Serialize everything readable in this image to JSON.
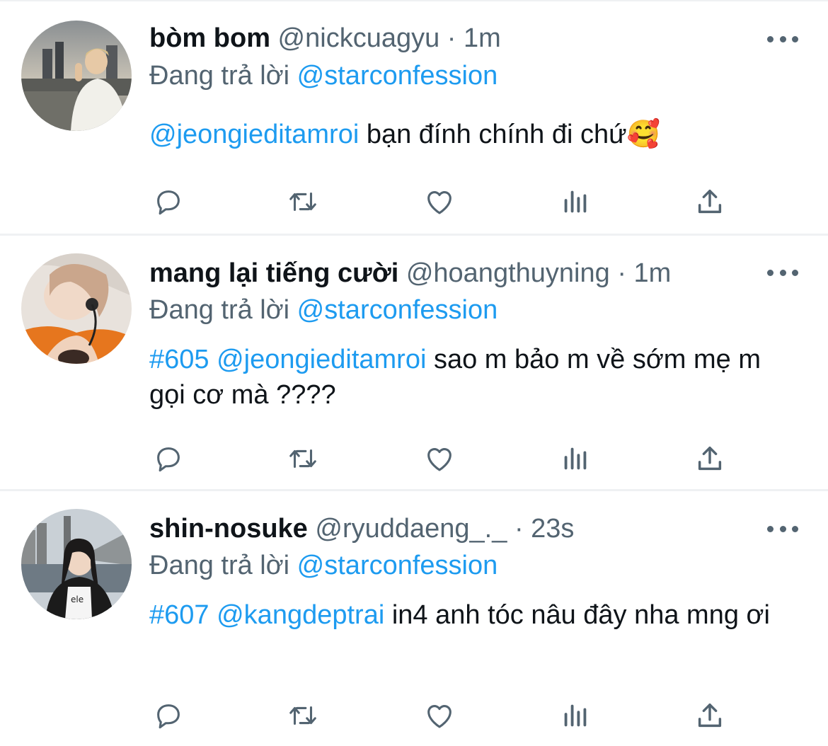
{
  "reply_label": "Đang trả lời",
  "tweets": [
    {
      "name": "bòm bom",
      "handle": "@nickcuagyu",
      "time": "1m",
      "replying_to": "@starconfession",
      "hashtag": "",
      "mention": "@jeongieditamroi",
      "text": " bạn đính chính đi chứ",
      "emoji": "🥰"
    },
    {
      "name": "mang lại tiếng cười",
      "handle": "@hoangthuyning",
      "time": "1m",
      "replying_to": "@starconfession",
      "hashtag": "#605",
      "mention": "@jeongieditamroi",
      "text": " sao m bảo m về sớm mẹ m gọi cơ mà ????",
      "emoji": ""
    },
    {
      "name": "shin-nosuke",
      "handle": "@ryuddaeng_._",
      "time": "23s",
      "replying_to": "@starconfession",
      "hashtag": "#607",
      "mention": "@kangdeptrai",
      "text": " in4 anh tóc nâu đây nha mng ơi",
      "emoji": ""
    }
  ],
  "icons": {
    "reply": "speech-bubble-icon",
    "retweet": "retweet-icon",
    "like": "heart-icon",
    "views": "bar-chart-icon",
    "share": "share-upload-icon",
    "more": "ellipsis-icon"
  },
  "colors": {
    "link": "#1d9bf0",
    "secondary": "#536471",
    "primary": "#0f1419"
  }
}
